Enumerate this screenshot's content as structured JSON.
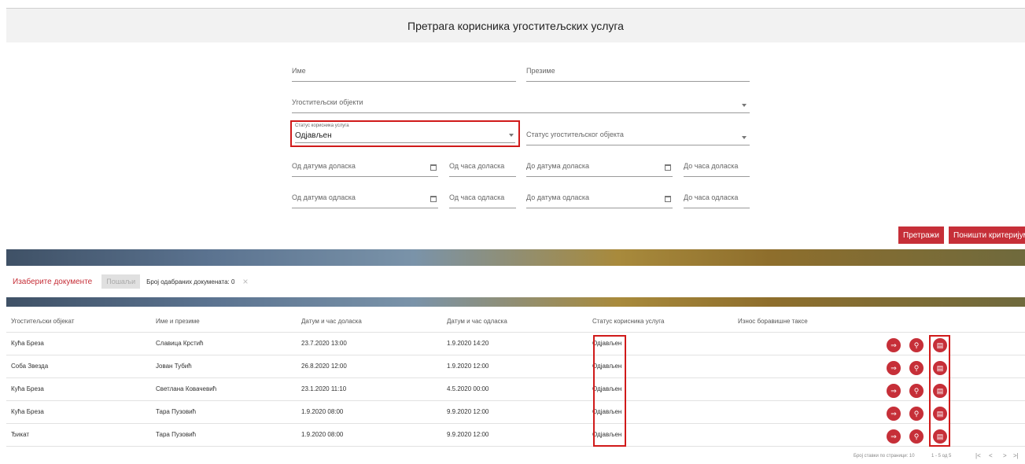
{
  "page": {
    "title": "Претрага корисника угоститељских услуга"
  },
  "form": {
    "first_name_label": "Име",
    "last_name_label": "Презиме",
    "facilities_label": "Угоститељски објекти",
    "user_status_label": "Статус корисника услуга",
    "user_status_value": "Одјављен",
    "facility_status_label": "Статус угоститељског објекта",
    "arrival_from_date_label": "Од датума доласка",
    "arrival_from_time_label": "Од часа доласка",
    "arrival_to_date_label": "До датума доласка",
    "arrival_to_time_label": "До часа доласка",
    "departure_from_date_label": "Од датума одласка",
    "departure_from_time_label": "Од часа одласка",
    "departure_to_date_label": "До датума одласка",
    "departure_to_time_label": "До часа одласка"
  },
  "actions": {
    "search_label": "Претражи",
    "reset_label": "Поништи критеријуме"
  },
  "toolbar": {
    "choose_docs_label": "Изаберите документе",
    "send_label": "Пошаљи",
    "selected_count_text": "Број одабраних докумената: 0",
    "clear_icon": "×"
  },
  "table": {
    "columns": [
      "Угоститељски објекат",
      "Име и презиме",
      "Датум и час доласка",
      "Датум и час одласка",
      "Статус корисника услуга",
      "Износ боравишне таксе"
    ],
    "rows": [
      [
        "Кућа Бреза",
        "Славица Крстић",
        "23.7.2020 13:00",
        "1.9.2020 14:20",
        "Одјављен",
        ""
      ],
      [
        "Соба Звезда",
        "Јован Тубић",
        "26.8.2020 12:00",
        "1.9.2020 12:00",
        "Одјављен",
        ""
      ],
      [
        "Кућа Бреза",
        "Светлана Ковачевић",
        "23.1.2020 11:10",
        "4.5.2020 00:00",
        "Одјављен",
        ""
      ],
      [
        "Кућа Бреза",
        "Тара Пузовић",
        "1.9.2020 08:00",
        "9.9.2020 12:00",
        "Одјављен",
        ""
      ],
      [
        "Ђикат",
        "Тара Пузовић",
        "1.9.2020 08:00",
        "9.9.2020 12:00",
        "Одјављен",
        ""
      ]
    ],
    "row_action_icons": [
      "login-icon",
      "search-icon",
      "document-icon"
    ]
  },
  "pagination": {
    "items_per_page_text": "Број ставки по страници: 10",
    "range_text": "1 - 5 од 5",
    "first_icon": "|<",
    "prev_icon": "<",
    "next_icon": ">",
    "last_icon": ">|"
  },
  "colors": {
    "accent": "#c62f38",
    "highlight": "#d01a1a"
  }
}
